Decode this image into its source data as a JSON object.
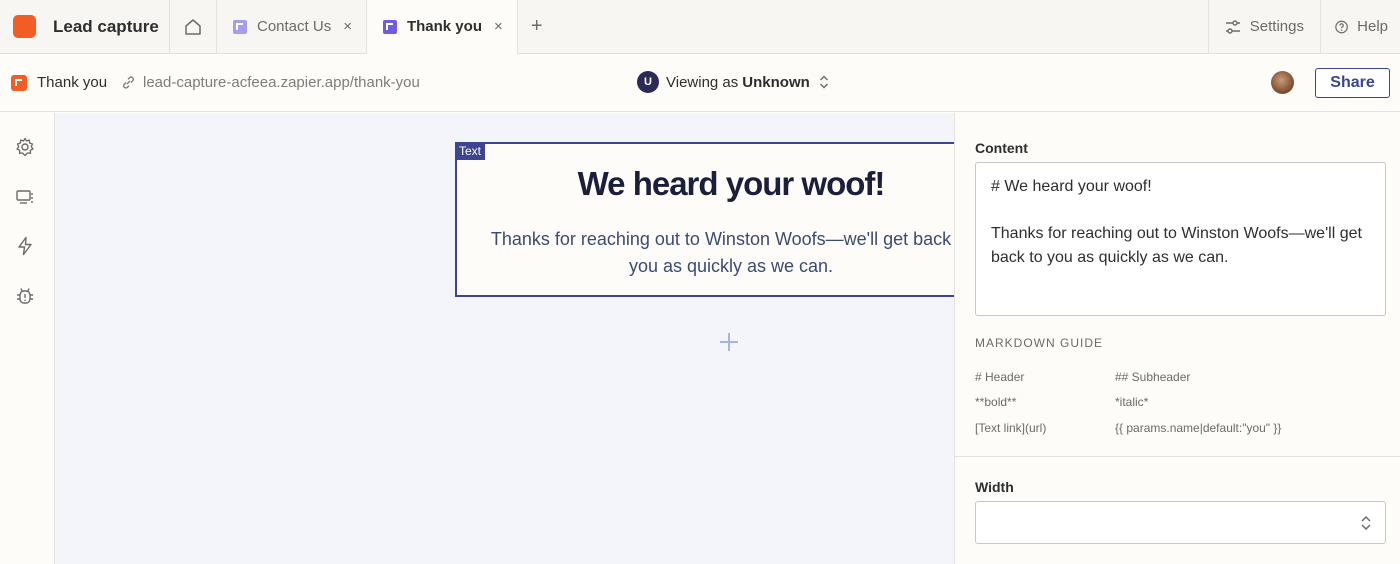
{
  "app": {
    "name": "Lead capture"
  },
  "tabs": [
    {
      "label": "Contact Us",
      "close": "×"
    },
    {
      "label": "Thank you",
      "close": "×"
    }
  ],
  "new_tab": "+",
  "top_actions": {
    "settings": "Settings",
    "help": "Help"
  },
  "pagebar": {
    "page_name": "Thank you",
    "url": "lead-capture-acfeea.zapier.app/thank-you",
    "viewing_prefix": "Viewing as",
    "viewing_user": "Unknown",
    "viewing_initial": "U",
    "share": "Share"
  },
  "canvas": {
    "block_tag": "Text",
    "heading": "We heard your woof!",
    "body": "Thanks for reaching out to Winston Woofs—we'll get back to you as quickly as we can."
  },
  "panel": {
    "content_label": "Content",
    "content_line1": "# We heard your woof!",
    "content_line2": "Thanks for reaching out to Winston Woofs—we'll get back to you as quickly as we can.",
    "markdown_title": "MARKDOWN GUIDE",
    "markdown": {
      "header": "# Header",
      "subheader": "## Subheader",
      "bold": "**bold**",
      "italic": "*italic*",
      "link": "[Text link](url)",
      "param": "{{ params.name|default:\"you\" }}"
    },
    "width_label": "Width",
    "width_value": ""
  },
  "colors": {
    "brand": "#f25d26",
    "accent": "#3d4592",
    "canvas_bg": "#f4f5fb"
  }
}
